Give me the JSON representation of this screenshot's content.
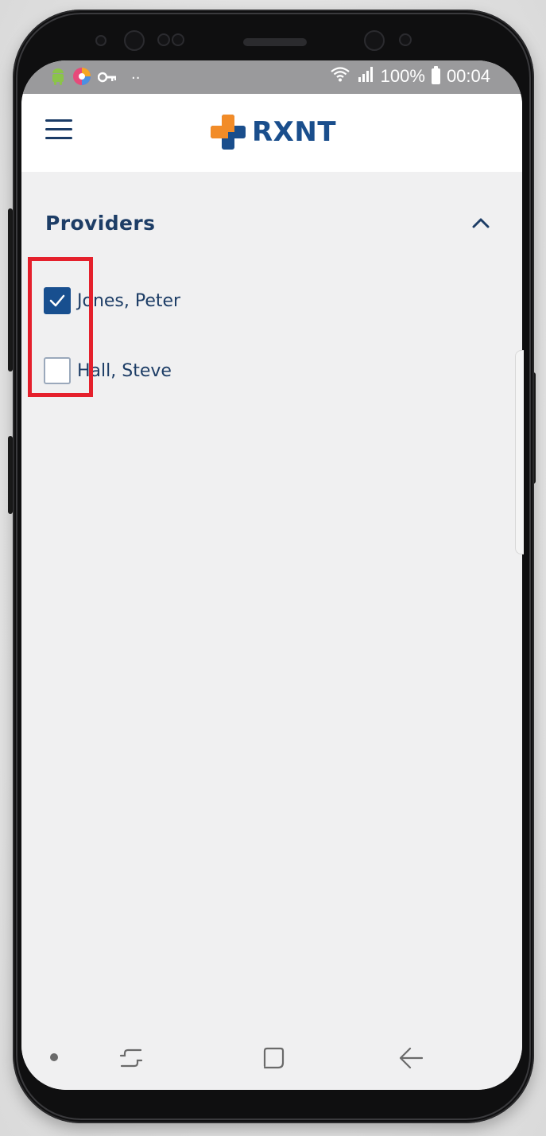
{
  "status_bar": {
    "battery_text": "100%",
    "time": "00:04",
    "dots": "··",
    "icons": [
      "android-icon",
      "color-app-icon",
      "key-icon",
      "wifi-icon",
      "signal-icon",
      "battery-icon"
    ]
  },
  "header": {
    "brand_name": "RXNT",
    "logo_colors": {
      "orange": "#f28c28",
      "blue": "#1a4e8c"
    },
    "menu_icon": "hamburger-menu-icon"
  },
  "providers": {
    "title": "Providers",
    "expanded": true,
    "items": [
      {
        "label": "Jones, Peter",
        "checked": true
      },
      {
        "label": "Hall, Steve",
        "checked": false
      }
    ]
  },
  "annotation": {
    "highlight_color": "#e5202c"
  },
  "nav_bar": {
    "buttons": [
      "recent-apps-icon",
      "home-icon",
      "back-icon"
    ]
  }
}
